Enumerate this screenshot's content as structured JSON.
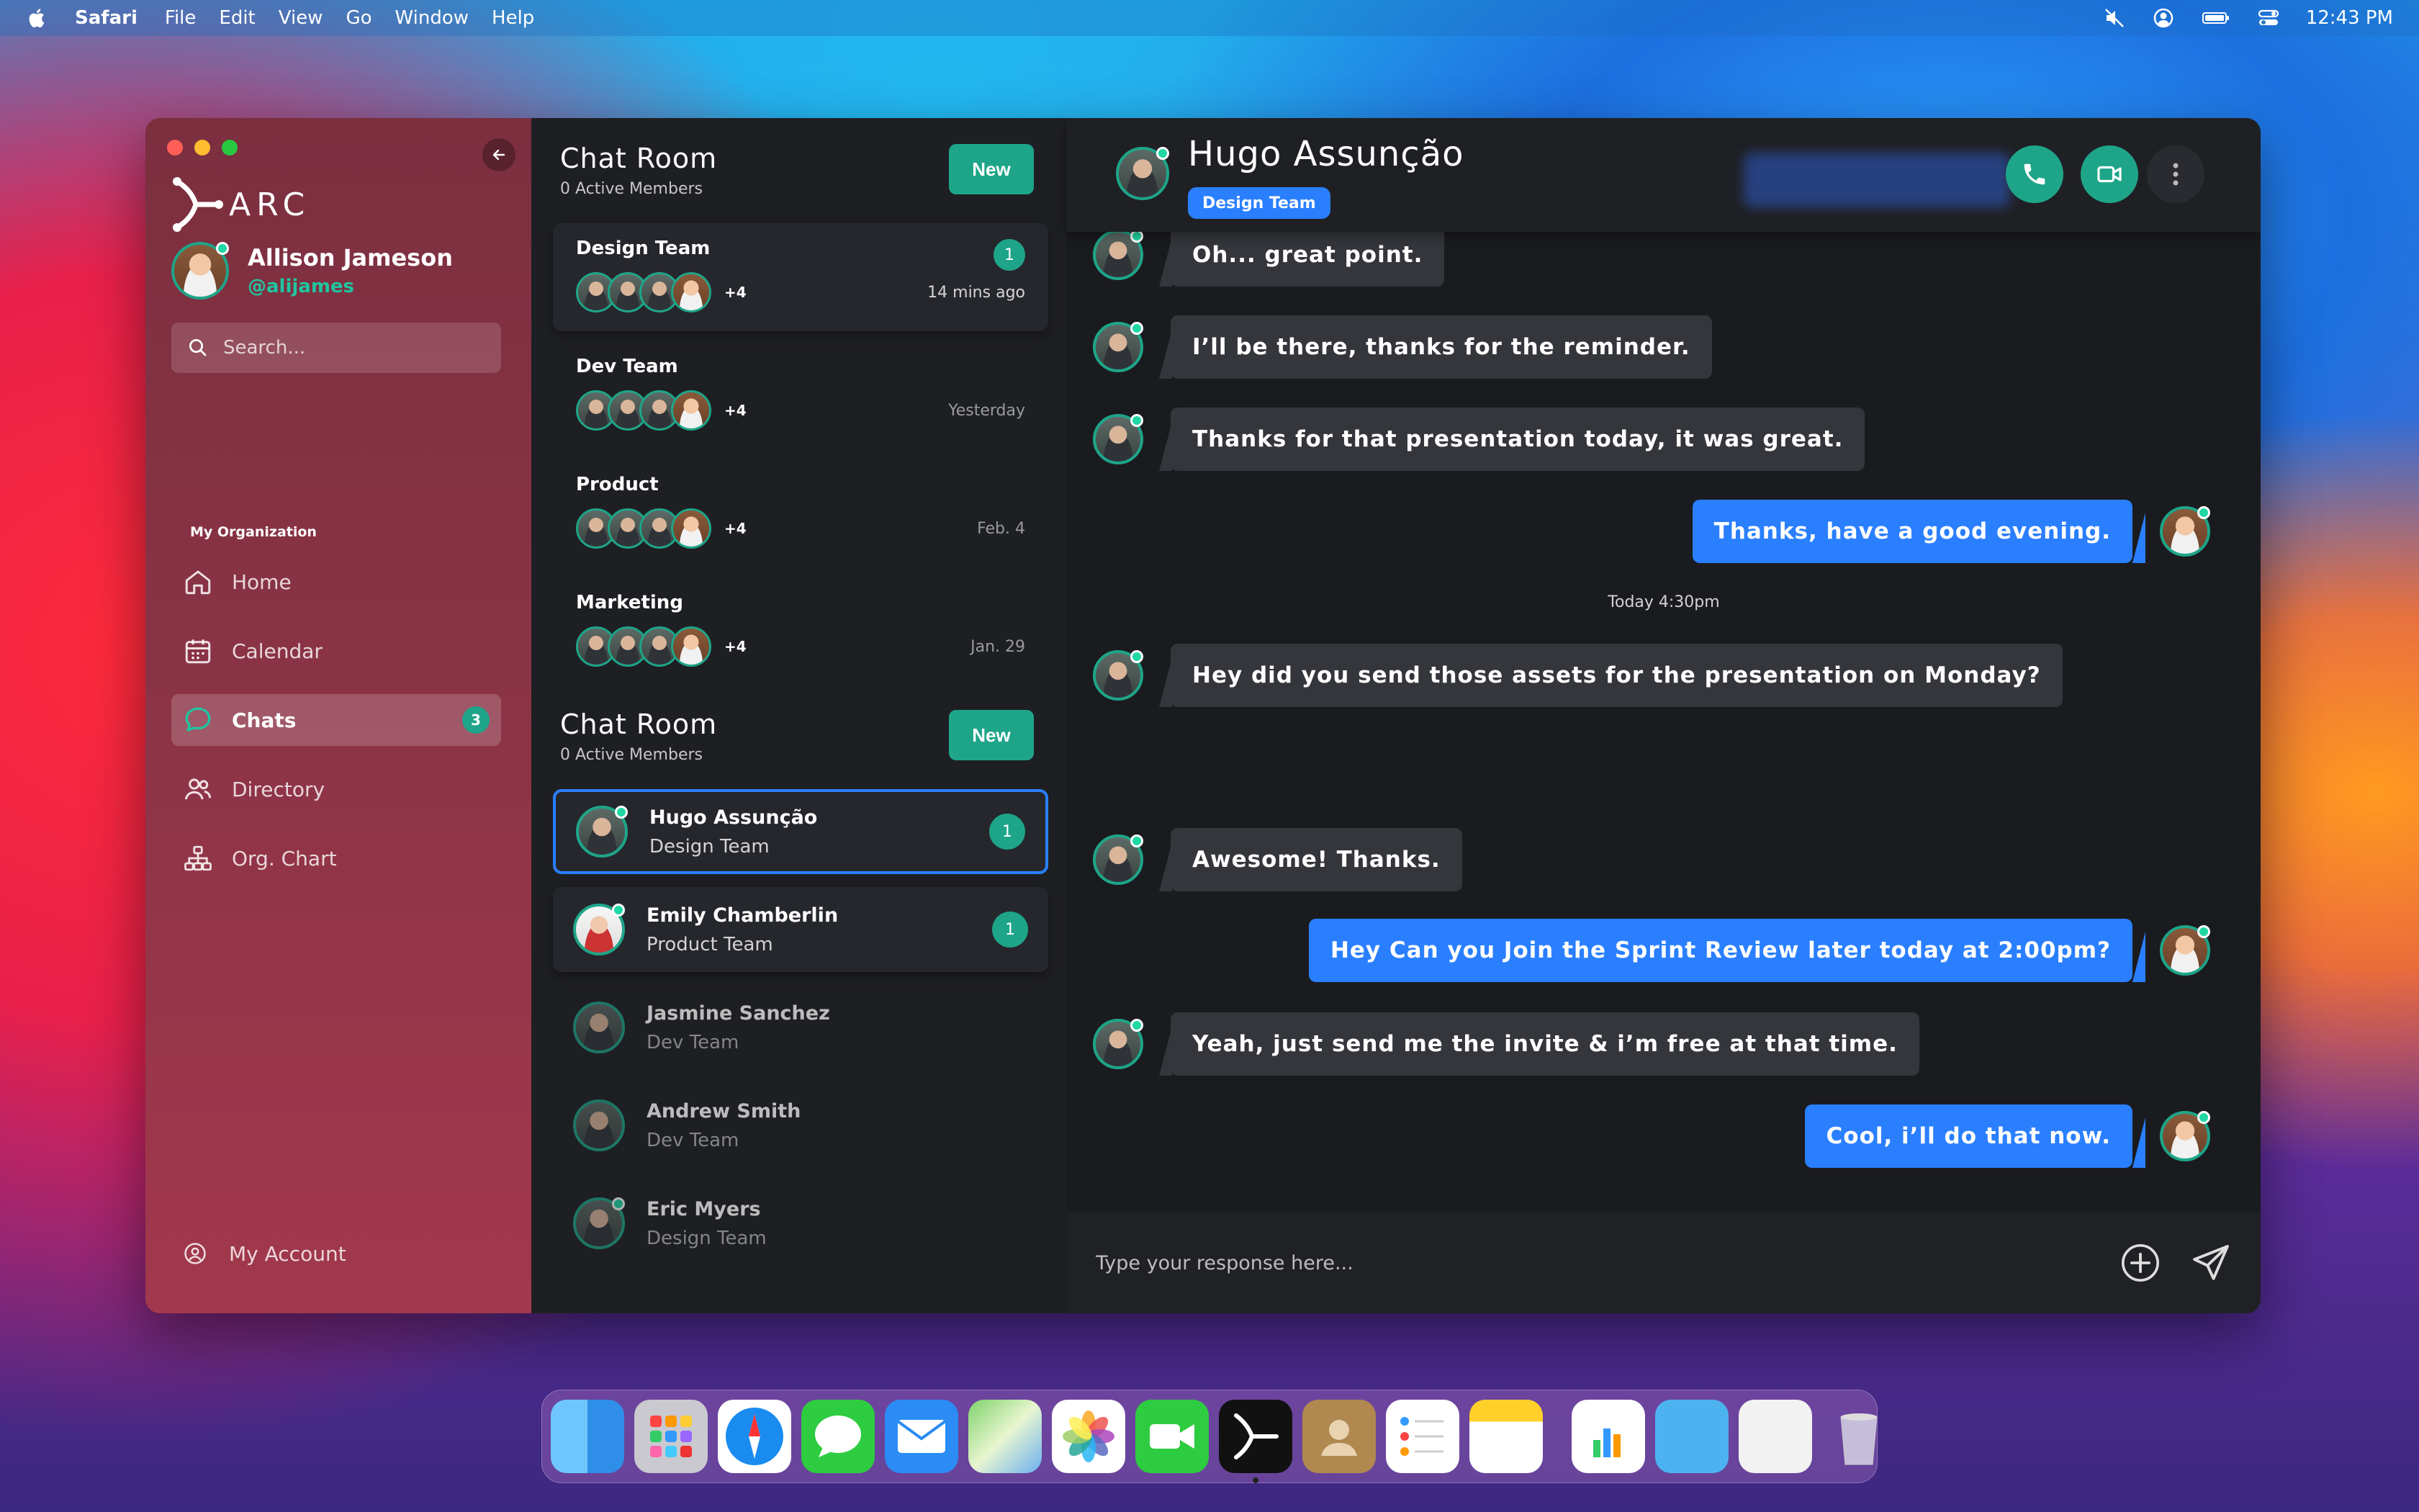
{
  "menubar": {
    "app": "Safari",
    "items": [
      "File",
      "Edit",
      "View",
      "Go",
      "Window",
      "Help"
    ],
    "time": "12:43 PM"
  },
  "sidebar": {
    "logo": "ARC",
    "user": {
      "name": "Allison Jameson",
      "handle": "@alijames"
    },
    "search_placeholder": "Search...",
    "org_label": "My Organization",
    "nav": [
      {
        "label": "Home",
        "icon": "home-icon"
      },
      {
        "label": "Calendar",
        "icon": "calendar-icon"
      },
      {
        "label": "Chats",
        "icon": "chat-icon",
        "badge": "3",
        "active": true
      },
      {
        "label": "Directory",
        "icon": "people-icon"
      },
      {
        "label": "Org. Chart",
        "icon": "org-chart-icon"
      }
    ],
    "account": "My Account"
  },
  "chatrooms": {
    "group_section": {
      "title": "Chat Room",
      "sub": "0 Active Members",
      "new_label": "New"
    },
    "groups": [
      {
        "name": "Design Team",
        "more": "+4",
        "time": "14 mins ago",
        "badge": "1"
      },
      {
        "name": "Dev Team",
        "more": "+4",
        "time": "Yesterday"
      },
      {
        "name": "Product",
        "more": "+4",
        "time": "Feb. 4"
      },
      {
        "name": "Marketing",
        "more": "+4",
        "time": "Jan. 29"
      }
    ],
    "dm_section": {
      "title": "Chat Room",
      "sub": "0 Active Members",
      "new_label": "New"
    },
    "dms": [
      {
        "name": "Hugo Assunção",
        "team": "Design Team",
        "badge": "1"
      },
      {
        "name": "Emily Chamberlin",
        "team": "Product Team",
        "badge": "1"
      },
      {
        "name": "Jasmine Sanchez",
        "team": "Dev Team"
      },
      {
        "name": "Andrew Smith",
        "team": "Dev Team"
      },
      {
        "name": "Eric Myers",
        "team": "Design Team"
      }
    ]
  },
  "conversation": {
    "name": "Hugo Assunção",
    "team": "Design Team",
    "messages": [
      {
        "from": "them",
        "text": "Oh... great point."
      },
      {
        "from": "them",
        "text": "I’ll be there, thanks for the reminder."
      },
      {
        "from": "them",
        "text": "Thanks for that presentation today, it was great."
      },
      {
        "from": "me",
        "text": "Thanks, have a good evening."
      },
      {
        "from": "them",
        "text": "Hey did you send those assets for the presentation on Monday?"
      },
      {
        "from": "them",
        "text": "Awesome! Thanks."
      },
      {
        "from": "me",
        "text": "Hey Can you Join the Sprint Review later today at 2:00pm?"
      },
      {
        "from": "them",
        "text": "Yeah, just send me the invite & i’m free at that time."
      },
      {
        "from": "me",
        "text": "Cool, i’ll do that now."
      }
    ],
    "timestamp": "Today 4:30pm",
    "composer_placeholder": "Type your response here..."
  },
  "colors": {
    "accent_green": "#1ea589",
    "accent_blue": "#2a7fff"
  }
}
